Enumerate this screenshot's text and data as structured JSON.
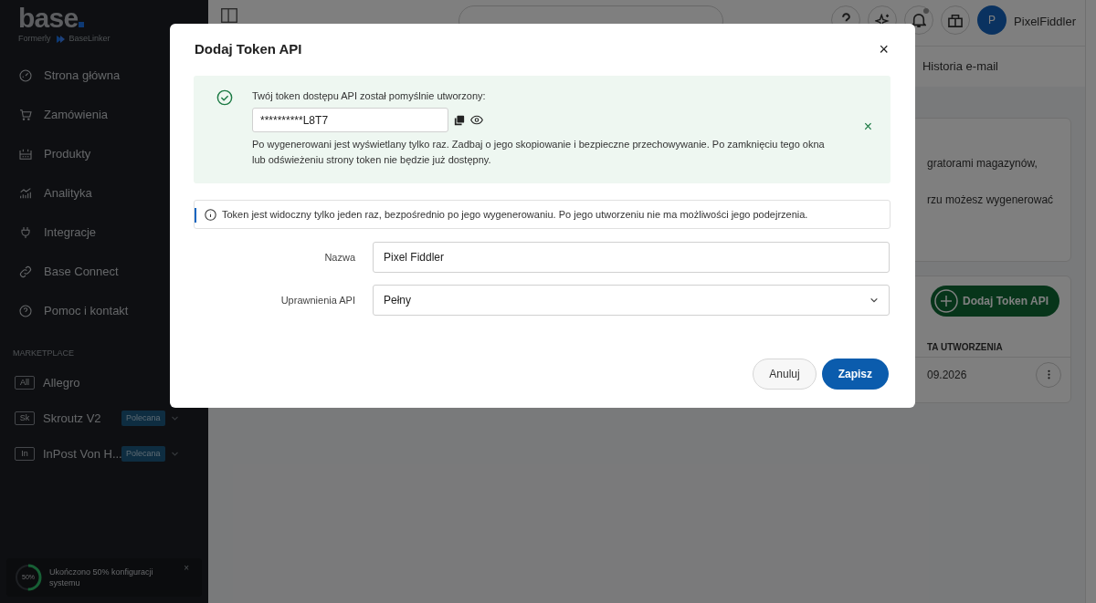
{
  "sidebar": {
    "logo": "base",
    "formerly": "Formerly",
    "former_brand": "BaseLinker",
    "nav": [
      {
        "label": "Strona główna"
      },
      {
        "label": "Zamówienia"
      },
      {
        "label": "Produkty"
      },
      {
        "label": "Analityka"
      },
      {
        "label": "Integracje"
      },
      {
        "label": "Base Connect"
      },
      {
        "label": "Pomoc i kontakt"
      }
    ],
    "section": "MARKETPLACE",
    "marketplaces": [
      {
        "code": "All",
        "label": "Allegro"
      },
      {
        "code": "Sk",
        "label": "Skroutz V2",
        "badge": "Polecana"
      },
      {
        "code": "In",
        "label": "InPost Von H...",
        "badge": "Polecana"
      }
    ],
    "setup": {
      "percent": "50%",
      "text": "Ukończono 50% konfiguracji systemu",
      "level": 0.5,
      "close": "×"
    }
  },
  "header": {
    "user_initial": "P",
    "user_name": "PixelFiddler"
  },
  "tabs": [
    {
      "label": "Historia e-mail"
    }
  ],
  "background_card": {
    "lines": [
      "gratorami magazynów,",
      "rzu możesz wygenerować"
    ]
  },
  "add_button": "Dodaj Token API",
  "table": {
    "columns": [
      "TA UTWORZENIA"
    ],
    "rows": [
      [
        "09.2026"
      ]
    ]
  },
  "modal": {
    "title": "Dodaj Token API",
    "close": "×",
    "success": {
      "heading": "Twój token dostępu API został pomyślnie utworzony:",
      "token": "**********L8T7",
      "note": "Po wygenerowani jest wyświetlany tylko raz. Zadbaj o jego skopiowanie i bezpieczne przechowywanie. Po zamknięciu tego okna lub odświeżeniu strony token nie będzie już dostępny.",
      "close": "×"
    },
    "info": "Token jest widoczny tylko jeden raz, bezpośrednio po jego wygenerowaniu. Po jego utworzeniu nie ma możliwości jego podejrzenia.",
    "fields": [
      {
        "kind": "text",
        "label": "Nazwa",
        "value": "Pixel Fiddler"
      },
      {
        "kind": "select",
        "label": "Uprawnienia API",
        "value": "Pełny"
      }
    ],
    "buttons": [
      {
        "label": "Anuluj",
        "primary": false
      },
      {
        "label": "Zapisz",
        "primary": true
      }
    ]
  }
}
